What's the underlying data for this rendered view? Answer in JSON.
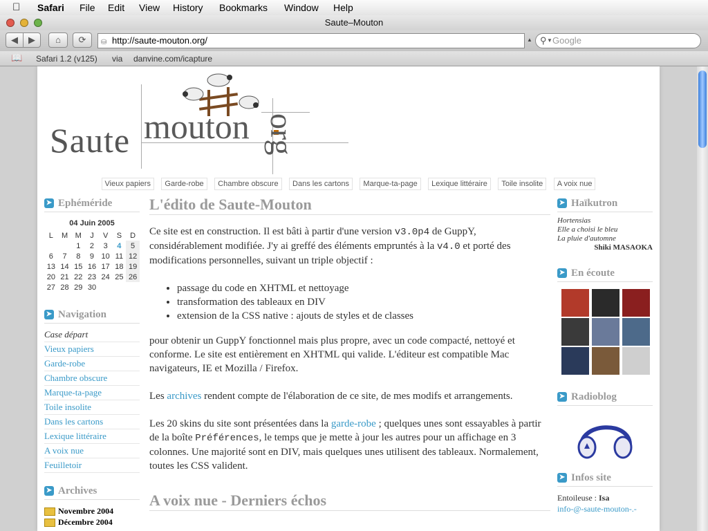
{
  "menubar": {
    "app": "Safari",
    "items": [
      "File",
      "Edit",
      "View",
      "History",
      "Bookmarks",
      "Window",
      "Help"
    ]
  },
  "window": {
    "title": "Saute–Mouton"
  },
  "toolbar": {
    "url": "http://saute-mouton.org/",
    "search_placeholder": "Google"
  },
  "bookmarks": [
    "Safari 1.2 (v125)",
    "via",
    "danvine.com/icapture"
  ],
  "logo": {
    "saute": "Saute",
    "mouton": "mouton",
    "org": "org"
  },
  "topnav": [
    "Vieux papiers",
    "Garde-robe",
    "Chambre obscure",
    "Dans les cartons",
    "Marque-ta-page",
    "Lexique littéraire",
    "Toile insolite",
    "A voix nue"
  ],
  "left": {
    "ephemeride_title": "Ephéméride",
    "calendar": {
      "title": "04 Juin 2005",
      "days": [
        "L",
        "M",
        "M",
        "J",
        "V",
        "S",
        "D"
      ],
      "weeks": [
        [
          "",
          "",
          "1",
          "2",
          "3",
          "4",
          "5"
        ],
        [
          "6",
          "7",
          "8",
          "9",
          "10",
          "11",
          "12"
        ],
        [
          "13",
          "14",
          "15",
          "16",
          "17",
          "18",
          "19"
        ],
        [
          "20",
          "21",
          "22",
          "23",
          "24",
          "25",
          "26"
        ],
        [
          "27",
          "28",
          "29",
          "30",
          "",
          "",
          ""
        ]
      ]
    },
    "navigation_title": "Navigation",
    "navigation": [
      "Case départ",
      "Vieux papiers",
      "Garde-robe",
      "Chambre obscure",
      "Marque-ta-page",
      "Toile insolite",
      "Dans les cartons",
      "Lexique littéraire",
      "A voix nue",
      "Feuilletoir"
    ],
    "archives_title": "Archives",
    "archives": [
      "Novembre 2004",
      "Décembre 2004"
    ]
  },
  "center": {
    "title": "L'édito de Saute-Mouton",
    "p1_a": "Ce site est en construction. Il est bâti à partir d'une version ",
    "p1_v3": "v3.0p4",
    "p1_b": " de GuppY, considérablement modifiée. J'y ai greffé des éléments empruntés à la ",
    "p1_v4": "v4.0",
    "p1_c": " et porté des modifications personnelles, suivant un triple objectif :",
    "bullets": [
      "passage du code en XHTML et nettoyage",
      "transformation des tableaux en DIV",
      "extension de la CSS native : ajouts de styles et de classes"
    ],
    "p2": "pour obtenir un GuppY fonctionnel mais plus propre, avec un code compacté, nettoyé et conforme. Le site est entièrement en XHTML qui valide. L'éditeur est compatible Mac navigateurs, IE et Mozilla / Firefox.",
    "p3_a": "Les ",
    "p3_link": "archives",
    "p3_b": " rendent compte de l'élaboration de ce site, de mes modifs et arrangements.",
    "p4_a": "Les 20 skins du site sont présentées dans la ",
    "p4_link": "garde-robe",
    "p4_b": " ; quelques unes sont essayables à partir de la boîte ",
    "p4_mono": "Préférences",
    "p4_c": ", le temps que je mette à jour les autres pour un affichage en 3 colonnes. Une majorité sont en DIV, mais quelques unes utilisent des tableaux. Normalement, toutes les CSS valident.",
    "title2": "A voix nue - Derniers échos"
  },
  "right": {
    "haikutron_title": "Haïkutron",
    "haiku": [
      "Hortensias",
      "Elle a choisi le bleu",
      "La pluie d'automne"
    ],
    "haiku_author": "Shiki MASAOKA",
    "ecoute_title": "En écoute",
    "albums": [
      "#b23a2a",
      "#2a2a2a",
      "#8a1f1f",
      "#3a3a3a",
      "#6a7a9a",
      "#4d6a8a",
      "#2a3a5a",
      "#7a5a3a",
      "#cfcfcf"
    ],
    "radioblog_title": "Radioblog",
    "infos_title": "Infos site",
    "entoileuse_label": "Entoileuse : ",
    "entoileuse_name": "Isa",
    "email": "info-@-saute-mouton-.-"
  }
}
